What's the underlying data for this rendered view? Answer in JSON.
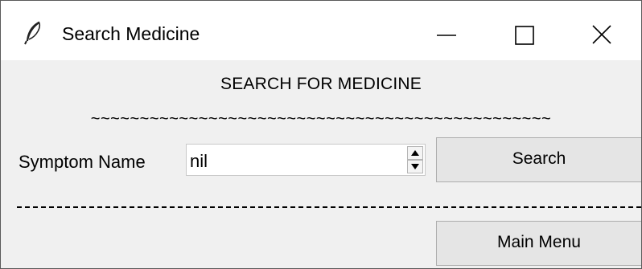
{
  "window": {
    "title": "Search Medicine",
    "icon": "feather-icon",
    "controls": [
      "minimize-icon",
      "maximize-icon",
      "close-icon"
    ]
  },
  "main": {
    "heading": "SEARCH FOR MEDICINE",
    "separator_text": "~~~~~~~~~~~~~~~~~~~~~~~~~~~~~~~~~~~~~~~~~~~~~~~",
    "symptom_label": "Symptom Name",
    "symptom_value": "nil",
    "search_label": "Search",
    "main_menu_label": "Main Menu"
  },
  "colors": {
    "window_bg": "#f0f0f0",
    "titlebar_bg": "#ffffff",
    "button_bg": "#e5e5e5",
    "button_border": "#adadad"
  }
}
